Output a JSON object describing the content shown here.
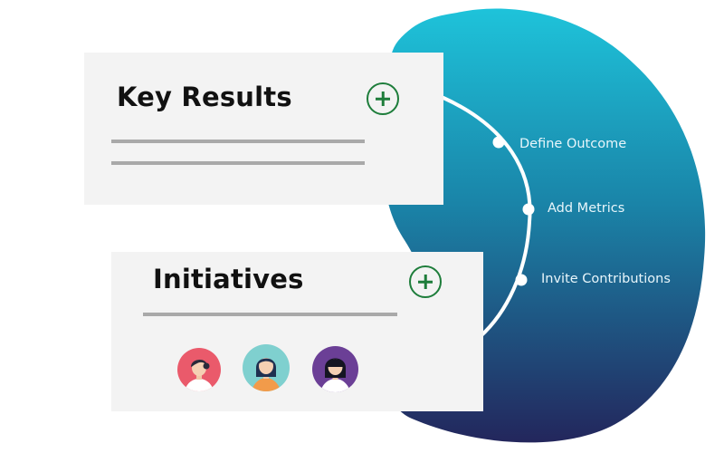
{
  "colors": {
    "blob_top": "#1dbfd8",
    "blob_bottom": "#22275e",
    "card_bg": "#f3f3f3",
    "plus_green": "#1e7d3b",
    "divider_gray": "#a9a9a9"
  },
  "key_results": {
    "title": "Key Results",
    "add_icon": "plus-circle-icon"
  },
  "initiatives": {
    "title": "Initiatives",
    "add_icon": "plus-circle-icon",
    "avatars": [
      "avatar-woman-pink",
      "avatar-woman-teal",
      "avatar-woman-purple"
    ]
  },
  "steps": [
    {
      "label": "Define Outcome"
    },
    {
      "label": "Add Metrics"
    },
    {
      "label": "Invite Contributions"
    }
  ]
}
